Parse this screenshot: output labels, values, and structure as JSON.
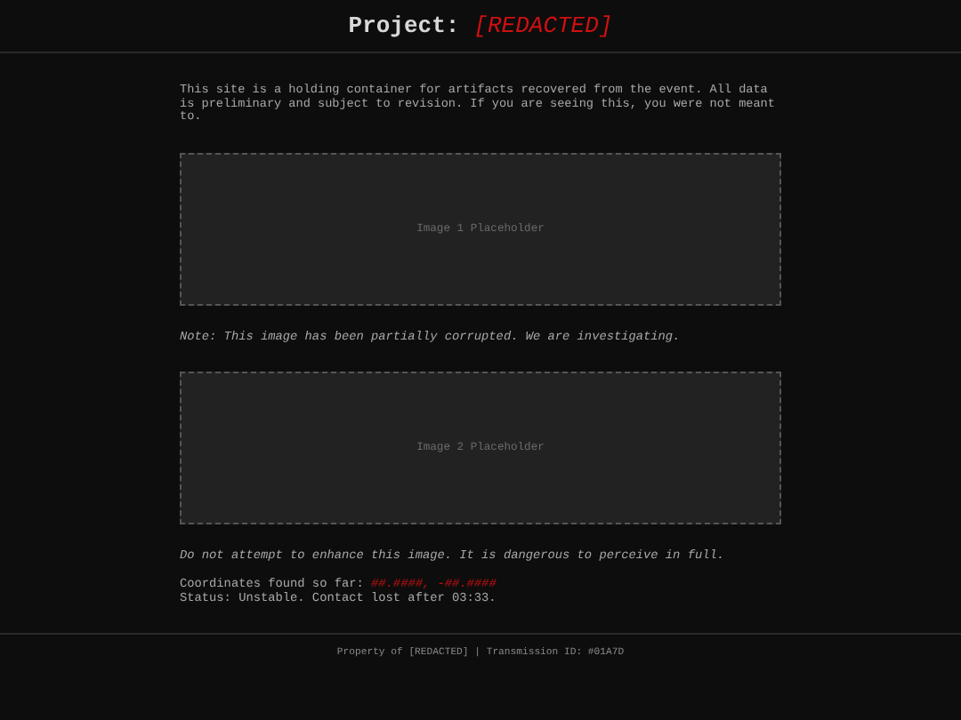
{
  "header": {
    "title": "Project:",
    "redacted": "[REDACTED]"
  },
  "intro": "This site is a holding container for artifacts recovered from the event. All data is preliminary and subject to revision. If you are seeing this, you were not meant to.",
  "images": [
    {
      "label": "Image 1 Placeholder",
      "caption": "Note: This image has been partially corrupted. We are investigating."
    },
    {
      "label": "Image 2 Placeholder",
      "caption": "Do not attempt to enhance this image. It is dangerous to perceive in full."
    }
  ],
  "coordinates": {
    "label": "Coordinates found so far:",
    "value": "##.####, -##.####"
  },
  "status": "Status: Unstable. Contact lost after 03:33.",
  "footer": "Property of [REDACTED] | Transmission ID: #01A7D"
}
